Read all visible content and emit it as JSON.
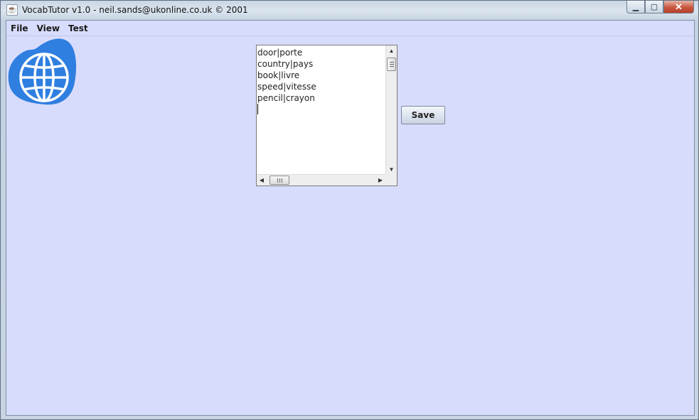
{
  "window": {
    "title": "VocabTutor v1.0 - neil.sands@ukonline.co.uk © 2001",
    "buttons": {
      "minimize": "minimize-icon",
      "maximize": "maximize-icon",
      "close": "close-icon"
    }
  },
  "menu": {
    "items": [
      {
        "label": "File"
      },
      {
        "label": "View"
      },
      {
        "label": "Test"
      }
    ]
  },
  "logo": {
    "icon": "globe-icon",
    "color": "#2f7fe0"
  },
  "editor": {
    "lines": [
      "door|porte",
      "country|pays",
      "book|livre",
      "speed|vitesse",
      "pencil|crayon"
    ]
  },
  "save_button": {
    "label": "Save"
  },
  "colors": {
    "client_background": "#d8dcfc",
    "title_background": "#c9d6e4"
  }
}
